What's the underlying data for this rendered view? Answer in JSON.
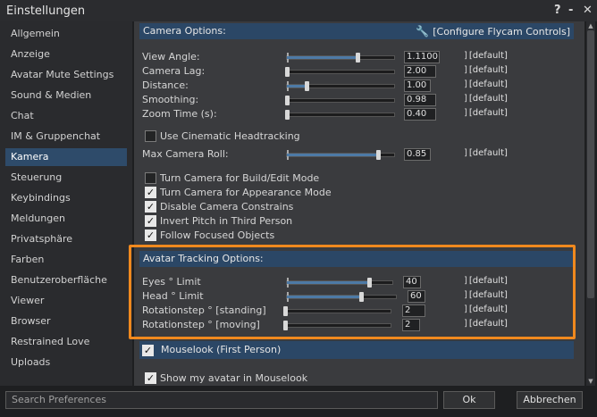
{
  "window": {
    "title": "Einstellungen",
    "help_label": "?",
    "minimize_label": "-",
    "close_label": "✕"
  },
  "sidebar": {
    "items": [
      {
        "label": "Allgemein"
      },
      {
        "label": "Anzeige"
      },
      {
        "label": "Avatar Mute Settings"
      },
      {
        "label": "Sound & Medien"
      },
      {
        "label": "Chat"
      },
      {
        "label": "IM & Gruppenchat"
      },
      {
        "label": "Kamera",
        "active": true
      },
      {
        "label": "Steuerung"
      },
      {
        "label": "Keybindings"
      },
      {
        "label": "Meldungen"
      },
      {
        "label": "Privatsphäre"
      },
      {
        "label": "Farben"
      },
      {
        "label": "Benutzeroberfläche"
      },
      {
        "label": "Viewer"
      },
      {
        "label": "Browser"
      },
      {
        "label": "Restrained Love"
      },
      {
        "label": "Uploads"
      }
    ]
  },
  "camera": {
    "header": "Camera Options:",
    "flycam_label": "[Configure Flycam Controls]",
    "default_label": "[default]",
    "sliders": [
      {
        "label": "View Angle:",
        "value": "1.1100",
        "level": 0.66
      },
      {
        "label": "Camera Lag:",
        "value": "2.00",
        "level": 0.0
      },
      {
        "label": "Distance:",
        "value": "1.00",
        "level": 0.18
      },
      {
        "label": "Smoothing:",
        "value": "0.98",
        "level": 0.0
      },
      {
        "label": "Zoom Time (s):",
        "value": "0.40",
        "level": 0.0
      }
    ],
    "cinematic_label": "Use Cinematic Headtracking",
    "max_roll": {
      "label": "Max Camera Roll:",
      "value": "0.85",
      "level": 0.85
    },
    "checks": [
      {
        "label": "Turn Camera for Build/Edit Mode",
        "checked": false
      },
      {
        "label": "Turn Camera for Appearance Mode",
        "checked": true
      },
      {
        "label": "Disable Camera Constrains",
        "checked": true
      },
      {
        "label": "Invert Pitch in Third Person",
        "checked": true
      },
      {
        "label": "Follow Focused Objects",
        "checked": true
      }
    ]
  },
  "avatar_tracking": {
    "header": "Avatar Tracking Options:",
    "rows": [
      {
        "label": "Eyes ° Limit",
        "value": "40",
        "level": 0.78
      },
      {
        "label": "Head ° Limit",
        "value": "60",
        "level": 0.68
      },
      {
        "label": "Rotationstep ° [standing]",
        "value": "2",
        "level": 0.0
      },
      {
        "label": "Rotationstep ° [moving]",
        "value": "2",
        "level": 0.0
      }
    ]
  },
  "mouselook": {
    "header": "Mouselook (First Person)",
    "show_avatar_label": "Show my avatar in Mouselook"
  },
  "footer": {
    "search_placeholder": "Search Preferences",
    "ok_label": "Ok",
    "cancel_label": "Abbrechen"
  },
  "colors": {
    "accent": "#2b4766",
    "highlight": "#f0891e",
    "slider_fill": "#4d7aa6"
  }
}
